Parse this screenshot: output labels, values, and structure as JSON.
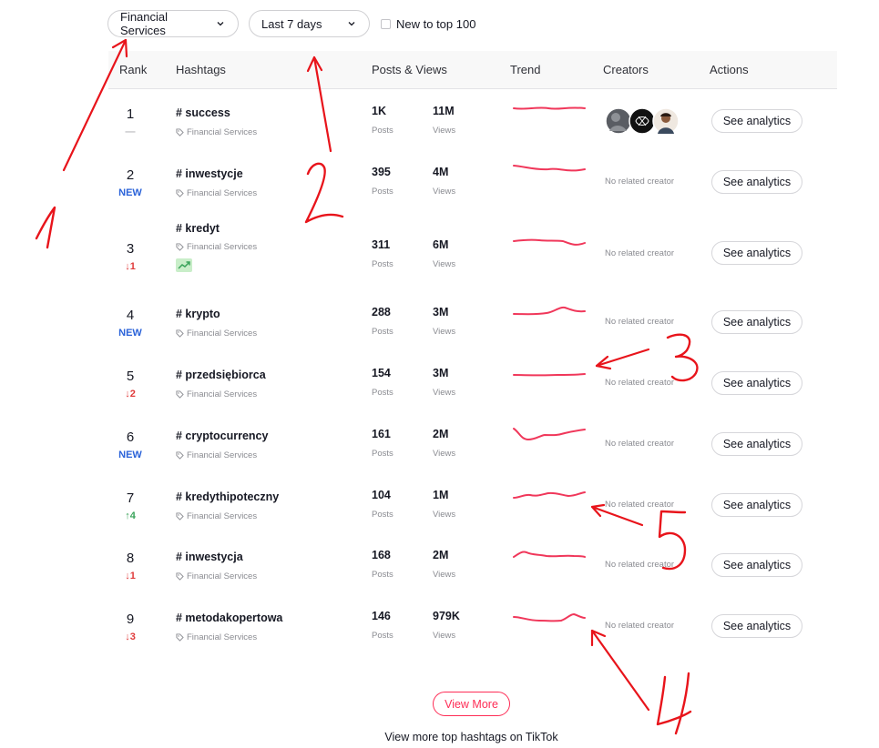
{
  "filters": {
    "industry": "Financial Services",
    "period": "Last 7 days",
    "new_to_top_label": "New to top 100"
  },
  "table": {
    "headers": {
      "rank": "Rank",
      "hashtags": "Hashtags",
      "posts_views": "Posts & Views",
      "trend": "Trend",
      "creators": "Creators",
      "actions": "Actions"
    },
    "posts_label": "Posts",
    "views_label": "Views",
    "analytics_label": "See analytics",
    "no_creator_label": "No related creator",
    "rows": [
      {
        "rank": "1",
        "change": "—",
        "change_type": "same",
        "hashtag": "# success",
        "industry": "Financial Services",
        "posts": "1K",
        "views": "11M"
      },
      {
        "rank": "2",
        "change": "NEW",
        "change_type": "new",
        "hashtag": "# inwestycje",
        "industry": "Financial Services",
        "posts": "395",
        "views": "4M"
      },
      {
        "rank": "3",
        "change": "↓1",
        "change_type": "down",
        "hashtag": "# kredyt",
        "industry": "Financial Services",
        "posts": "311",
        "views": "6M"
      },
      {
        "rank": "4",
        "change": "NEW",
        "change_type": "new",
        "hashtag": "# krypto",
        "industry": "Financial Services",
        "posts": "288",
        "views": "3M"
      },
      {
        "rank": "5",
        "change": "↓2",
        "change_type": "down",
        "hashtag": "# przedsiębiorca",
        "industry": "Financial Services",
        "posts": "154",
        "views": "3M"
      },
      {
        "rank": "6",
        "change": "NEW",
        "change_type": "new",
        "hashtag": "# cryptocurrency",
        "industry": "Financial Services",
        "posts": "161",
        "views": "2M"
      },
      {
        "rank": "7",
        "change": "↑4",
        "change_type": "up",
        "hashtag": "# kredythipoteczny",
        "industry": "Financial Services",
        "posts": "104",
        "views": "1M"
      },
      {
        "rank": "8",
        "change": "↓1",
        "change_type": "down",
        "hashtag": "# inwestycja",
        "industry": "Financial Services",
        "posts": "168",
        "views": "2M"
      },
      {
        "rank": "9",
        "change": "↓3",
        "change_type": "down",
        "hashtag": "# metodakopertowa",
        "industry": "Financial Services",
        "posts": "146",
        "views": "979K"
      }
    ]
  },
  "view_more_label": "View More",
  "footer_link": "View more top hashtags on TikTok",
  "annotations": [
    "1",
    "2",
    "3",
    "4",
    "5"
  ],
  "colors": {
    "accent": "#fe2c55",
    "trend_line": "#f0375a",
    "annotation": "#e8141b",
    "new_badge": "#2b63d9",
    "down": "#e03a3a",
    "up": "#3aa35a"
  },
  "icons": {
    "chevron": "chevron-down-icon",
    "tag": "tag-icon",
    "trending": "trending-up-icon"
  }
}
